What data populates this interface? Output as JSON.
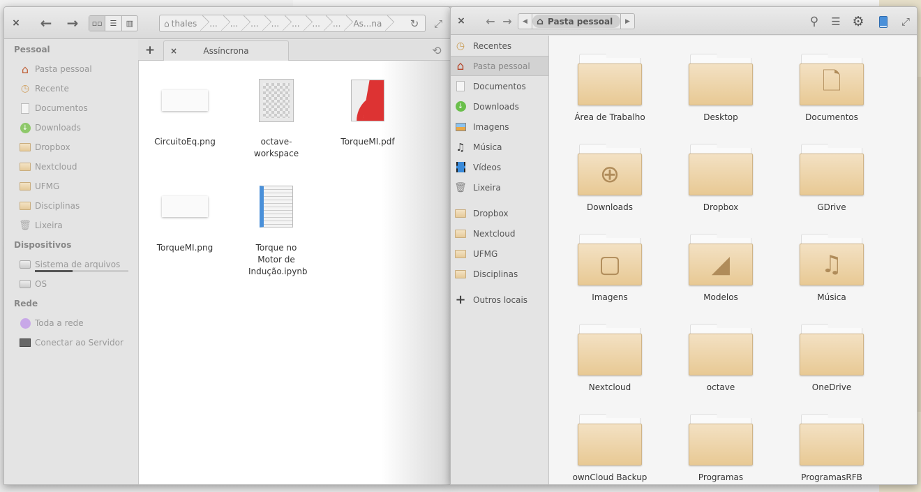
{
  "window1": {
    "close_label": "×",
    "back_icon": "←",
    "forward_icon": "→",
    "view_modes": [
      "grid-view",
      "list-view",
      "column-view"
    ],
    "view_icons": [
      "▫▫",
      "☰",
      "▥"
    ],
    "path": {
      "home_label": "thales",
      "crumbs": [
        "...",
        "...",
        "...",
        "...",
        "...",
        "...",
        "...",
        "As...na"
      ],
      "reload_icon": "↻"
    },
    "maximize_icon": "⤢",
    "sidebar": {
      "sections": [
        {
          "title": "Pessoal",
          "items": [
            {
              "label": "Pasta pessoal",
              "icon": "home-icon"
            },
            {
              "label": "Recente",
              "icon": "recent-icon"
            },
            {
              "label": "Documentos",
              "icon": "document-icon"
            },
            {
              "label": "Downloads",
              "icon": "download-icon"
            },
            {
              "label": "Dropbox",
              "icon": "folder-icon"
            },
            {
              "label": "Nextcloud",
              "icon": "folder-icon"
            },
            {
              "label": "UFMG",
              "icon": "folder-icon"
            },
            {
              "label": "Disciplinas",
              "icon": "folder-icon"
            },
            {
              "label": "Lixeira",
              "icon": "trash-icon"
            }
          ]
        },
        {
          "title": "Dispositivos",
          "items": [
            {
              "label": "Sistema de arquivos",
              "icon": "drive-icon",
              "usage_fraction": 0.4
            },
            {
              "label": "OS",
              "icon": "drive-icon"
            }
          ]
        },
        {
          "title": "Rede",
          "items": [
            {
              "label": "Toda a rede",
              "icon": "network-icon"
            },
            {
              "label": "Conectar ao Servidor",
              "icon": "server-icon"
            }
          ]
        }
      ]
    },
    "tabs": {
      "new_tab": "+",
      "tab_close": "×",
      "active_tab": "Assíncrona",
      "history_icon": "⟲"
    },
    "files": [
      {
        "name": "CircuitoEq.png",
        "type": "image"
      },
      {
        "name": "octave-workspace",
        "type": "generic"
      },
      {
        "name": "TorqueMI.pdf",
        "type": "pdf"
      },
      {
        "name": "TorqueMI.png",
        "type": "image"
      },
      {
        "name": "Torque no Motor de Indução.ipynb",
        "type": "text"
      }
    ]
  },
  "window2": {
    "close_label": "×",
    "back_icon": "←",
    "forward_icon": "→",
    "path": {
      "prev": "◀",
      "home_label": "Pasta pessoal",
      "next": "▶"
    },
    "toolbar": {
      "search_icon": "⚲",
      "menu_icon": "☰",
      "settings_icon": "⚙",
      "maximize_icon": "⤢"
    },
    "sidebar": [
      {
        "label": "Recentes",
        "icon": "recent-icon"
      },
      {
        "label": "Pasta pessoal",
        "icon": "home-icon",
        "selected": true
      },
      {
        "label": "Documentos",
        "icon": "document-icon"
      },
      {
        "label": "Downloads",
        "icon": "download-icon"
      },
      {
        "label": "Imagens",
        "icon": "images-icon"
      },
      {
        "label": "Música",
        "icon": "music-icon"
      },
      {
        "label": "Vídeos",
        "icon": "video-icon"
      },
      {
        "label": "Lixeira",
        "icon": "trash-icon"
      },
      {
        "label": "Dropbox",
        "icon": "folder-icon"
      },
      {
        "label": "Nextcloud",
        "icon": "folder-icon"
      },
      {
        "label": "UFMG",
        "icon": "folder-icon"
      },
      {
        "label": "Disciplinas",
        "icon": "folder-icon"
      },
      {
        "label": "Outros locais",
        "icon": "plus-icon"
      }
    ],
    "folders": [
      {
        "name": "Área de Trabalho",
        "emblem": ""
      },
      {
        "name": "Desktop",
        "emblem": ""
      },
      {
        "name": "Documentos",
        "emblem": "🗋"
      },
      {
        "name": "Downloads",
        "emblem": "⊕"
      },
      {
        "name": "Dropbox",
        "emblem": ""
      },
      {
        "name": "GDrive",
        "emblem": ""
      },
      {
        "name": "Imagens",
        "emblem": "▢"
      },
      {
        "name": "Modelos",
        "emblem": "◢"
      },
      {
        "name": "Música",
        "emblem": "♫"
      },
      {
        "name": "Nextcloud",
        "emblem": ""
      },
      {
        "name": "octave",
        "emblem": ""
      },
      {
        "name": "OneDrive",
        "emblem": ""
      },
      {
        "name": "ownCloud Backup",
        "emblem": ""
      },
      {
        "name": "Programas",
        "emblem": ""
      },
      {
        "name": "ProgramasRFB",
        "emblem": ""
      }
    ]
  },
  "colors": {
    "folder": "#e8c994",
    "accent_blue": "#4a90d9",
    "download_green": "#6abf4b"
  }
}
